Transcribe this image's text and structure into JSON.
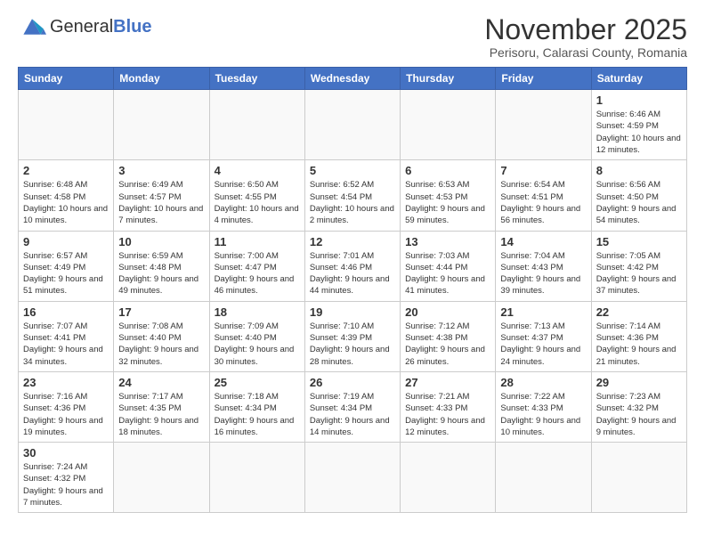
{
  "logo": {
    "text_normal": "General",
    "text_bold": "Blue"
  },
  "title": "November 2025",
  "location": "Perisoru, Calarasi County, Romania",
  "days_of_week": [
    "Sunday",
    "Monday",
    "Tuesday",
    "Wednesday",
    "Thursday",
    "Friday",
    "Saturday"
  ],
  "weeks": [
    [
      {
        "day": "",
        "info": ""
      },
      {
        "day": "",
        "info": ""
      },
      {
        "day": "",
        "info": ""
      },
      {
        "day": "",
        "info": ""
      },
      {
        "day": "",
        "info": ""
      },
      {
        "day": "",
        "info": ""
      },
      {
        "day": "1",
        "info": "Sunrise: 6:46 AM\nSunset: 4:59 PM\nDaylight: 10 hours and 12 minutes."
      }
    ],
    [
      {
        "day": "2",
        "info": "Sunrise: 6:48 AM\nSunset: 4:58 PM\nDaylight: 10 hours and 10 minutes."
      },
      {
        "day": "3",
        "info": "Sunrise: 6:49 AM\nSunset: 4:57 PM\nDaylight: 10 hours and 7 minutes."
      },
      {
        "day": "4",
        "info": "Sunrise: 6:50 AM\nSunset: 4:55 PM\nDaylight: 10 hours and 4 minutes."
      },
      {
        "day": "5",
        "info": "Sunrise: 6:52 AM\nSunset: 4:54 PM\nDaylight: 10 hours and 2 minutes."
      },
      {
        "day": "6",
        "info": "Sunrise: 6:53 AM\nSunset: 4:53 PM\nDaylight: 9 hours and 59 minutes."
      },
      {
        "day": "7",
        "info": "Sunrise: 6:54 AM\nSunset: 4:51 PM\nDaylight: 9 hours and 56 minutes."
      },
      {
        "day": "8",
        "info": "Sunrise: 6:56 AM\nSunset: 4:50 PM\nDaylight: 9 hours and 54 minutes."
      }
    ],
    [
      {
        "day": "9",
        "info": "Sunrise: 6:57 AM\nSunset: 4:49 PM\nDaylight: 9 hours and 51 minutes."
      },
      {
        "day": "10",
        "info": "Sunrise: 6:59 AM\nSunset: 4:48 PM\nDaylight: 9 hours and 49 minutes."
      },
      {
        "day": "11",
        "info": "Sunrise: 7:00 AM\nSunset: 4:47 PM\nDaylight: 9 hours and 46 minutes."
      },
      {
        "day": "12",
        "info": "Sunrise: 7:01 AM\nSunset: 4:46 PM\nDaylight: 9 hours and 44 minutes."
      },
      {
        "day": "13",
        "info": "Sunrise: 7:03 AM\nSunset: 4:44 PM\nDaylight: 9 hours and 41 minutes."
      },
      {
        "day": "14",
        "info": "Sunrise: 7:04 AM\nSunset: 4:43 PM\nDaylight: 9 hours and 39 minutes."
      },
      {
        "day": "15",
        "info": "Sunrise: 7:05 AM\nSunset: 4:42 PM\nDaylight: 9 hours and 37 minutes."
      }
    ],
    [
      {
        "day": "16",
        "info": "Sunrise: 7:07 AM\nSunset: 4:41 PM\nDaylight: 9 hours and 34 minutes."
      },
      {
        "day": "17",
        "info": "Sunrise: 7:08 AM\nSunset: 4:40 PM\nDaylight: 9 hours and 32 minutes."
      },
      {
        "day": "18",
        "info": "Sunrise: 7:09 AM\nSunset: 4:40 PM\nDaylight: 9 hours and 30 minutes."
      },
      {
        "day": "19",
        "info": "Sunrise: 7:10 AM\nSunset: 4:39 PM\nDaylight: 9 hours and 28 minutes."
      },
      {
        "day": "20",
        "info": "Sunrise: 7:12 AM\nSunset: 4:38 PM\nDaylight: 9 hours and 26 minutes."
      },
      {
        "day": "21",
        "info": "Sunrise: 7:13 AM\nSunset: 4:37 PM\nDaylight: 9 hours and 24 minutes."
      },
      {
        "day": "22",
        "info": "Sunrise: 7:14 AM\nSunset: 4:36 PM\nDaylight: 9 hours and 21 minutes."
      }
    ],
    [
      {
        "day": "23",
        "info": "Sunrise: 7:16 AM\nSunset: 4:36 PM\nDaylight: 9 hours and 19 minutes."
      },
      {
        "day": "24",
        "info": "Sunrise: 7:17 AM\nSunset: 4:35 PM\nDaylight: 9 hours and 18 minutes."
      },
      {
        "day": "25",
        "info": "Sunrise: 7:18 AM\nSunset: 4:34 PM\nDaylight: 9 hours and 16 minutes."
      },
      {
        "day": "26",
        "info": "Sunrise: 7:19 AM\nSunset: 4:34 PM\nDaylight: 9 hours and 14 minutes."
      },
      {
        "day": "27",
        "info": "Sunrise: 7:21 AM\nSunset: 4:33 PM\nDaylight: 9 hours and 12 minutes."
      },
      {
        "day": "28",
        "info": "Sunrise: 7:22 AM\nSunset: 4:33 PM\nDaylight: 9 hours and 10 minutes."
      },
      {
        "day": "29",
        "info": "Sunrise: 7:23 AM\nSunset: 4:32 PM\nDaylight: 9 hours and 9 minutes."
      }
    ],
    [
      {
        "day": "30",
        "info": "Sunrise: 7:24 AM\nSunset: 4:32 PM\nDaylight: 9 hours and 7 minutes."
      },
      {
        "day": "",
        "info": ""
      },
      {
        "day": "",
        "info": ""
      },
      {
        "day": "",
        "info": ""
      },
      {
        "day": "",
        "info": ""
      },
      {
        "day": "",
        "info": ""
      },
      {
        "day": "",
        "info": ""
      }
    ]
  ]
}
